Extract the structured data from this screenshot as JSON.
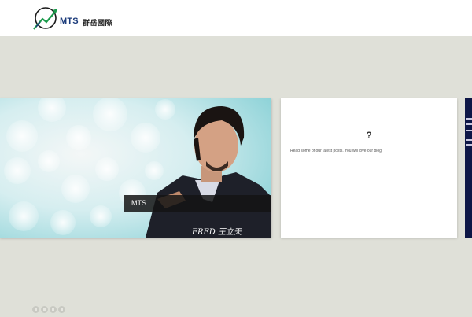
{
  "header": {
    "logo_text": "MTS",
    "logo_chinese": "群岳國際"
  },
  "slider": {
    "main_caption": "MTS",
    "signature": "FRED 王立天",
    "card_title": "?",
    "card_text": "Read some of our latest posts. You will love our blog!"
  },
  "footer": {
    "social_icons": [
      "facebook-icon",
      "twitter-icon",
      "google-plus-icon",
      "vimeo-icon"
    ]
  },
  "colors": {
    "page_background": "#dfe0d8",
    "header_background": "#ffffff",
    "caption_background": "#141414",
    "logo_blue": "#1a3a7a",
    "logo_green": "#1c9b4c"
  }
}
